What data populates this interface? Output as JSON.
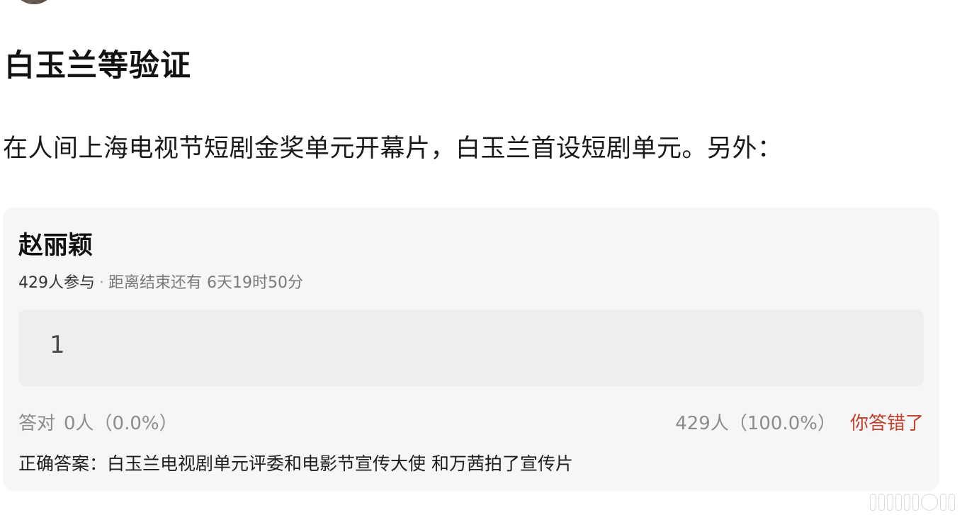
{
  "post": {
    "title": "白玉兰等验证",
    "body": "在人间上海电视节短剧金奖单元开幕片，白玉兰首设短剧单元。另外："
  },
  "quiz": {
    "name": "赵丽颖",
    "participants": "429人参与",
    "separator": "·",
    "countdown": "距离结束还有 6天19时50分",
    "answer_value": "1",
    "correct_label": "答对",
    "correct_stat": "0人（0.0%）",
    "wrong_stat": "429人（100.0%）",
    "verdict": "你答错了",
    "correct_answer": "正确答案：白玉兰电视剧单元评委和电影节宣传大使 和万茜拍了宣传片"
  },
  "colors": {
    "card_bg": "#f6f6f6",
    "answer_bg": "#eeeeee",
    "verdict_red": "#c2412d",
    "muted_gray": "#8c8c8c"
  }
}
